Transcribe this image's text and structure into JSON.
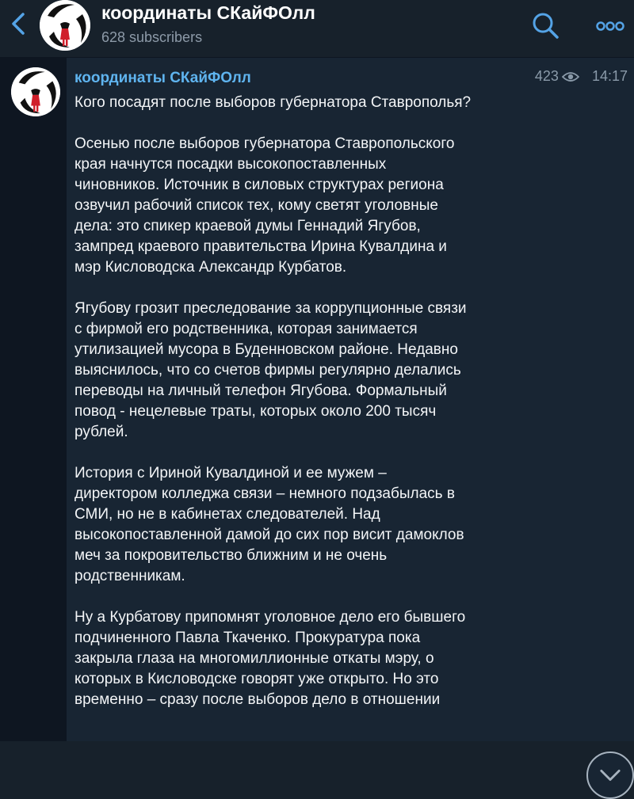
{
  "channel": {
    "name": "координаты СКайФОлл",
    "subscribers": "628 subscribers"
  },
  "post": {
    "author": "координаты СКайФОлл",
    "views": "423",
    "time": "14:17",
    "paragraphs": [
      [
        "Кого посадят после выборов губернатора Ставрополья?"
      ],
      [
        "Осенью после выборов губернатора Ставропольского",
        "края начнутся посадки высокопоставленных",
        "чиновников. Источник в силовых структурах региона",
        "озвучил рабочий список тех, кому светят уголовные",
        "дела: это спикер краевой думы Геннадий Ягубов,",
        "зампред краевого правительства Ирина Кувалдина и",
        "мэр Кисловодска Александр Курбатов."
      ],
      [
        "Ягубову грозит преследование за коррупционные связи",
        "с фирмой его родственника, которая занимается",
        "утилизацией мусора в Буденновском районе. Недавно",
        "выяснилось, что со счетов фирмы регулярно делались",
        "переводы на личный телефон Ягубова. Формальный",
        "повод - нецелевые траты, которых около 200 тысяч",
        "рублей."
      ],
      [
        "История с Ириной Кувалдиной и ее мужем –",
        "директором колледжа связи – немного подзабылась в",
        "СМИ, но не в кабинетах следователей. Над",
        "высокопоставленной дамой до сих пор висит дамоклов",
        "меч за покровительство ближним и не очень",
        "родственникам."
      ],
      [
        "Ну а Курбатову припомнят уголовное дело его бывшего",
        "подчиненного Павла Ткаченко. Прокуратура пока",
        "закрыла глаза на многомиллионные откаты мэру, о",
        "которых в Кисловодске говорят уже открыто. Но это",
        "временно – сразу после выборов дело в отношении"
      ]
    ]
  },
  "icons": {
    "back": "chevron-left-icon",
    "search": "search-icon",
    "more": "more-icon",
    "views": "eye-icon",
    "scroll": "chevron-down-icon"
  },
  "colors": {
    "background": "#0e1621",
    "header": "#17212b",
    "bubble": "#182533",
    "accent": "#5fb4ef",
    "link_icons": "#54a3e6"
  }
}
